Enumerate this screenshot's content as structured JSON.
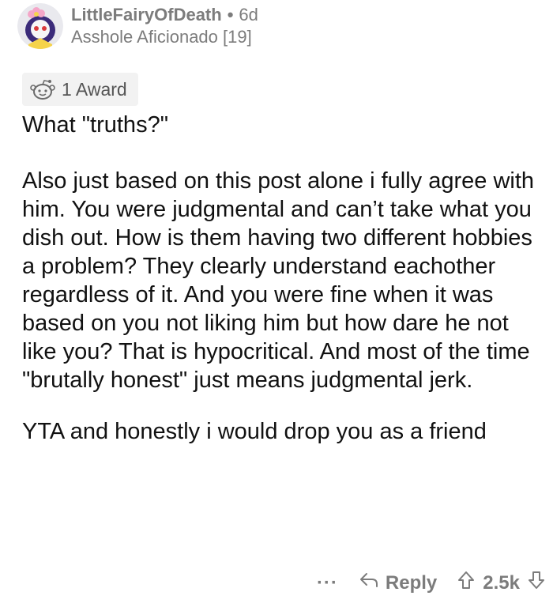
{
  "comment": {
    "username": "LittleFairyOfDeath",
    "separator": "•",
    "age": "6d",
    "flair": "Asshole Aficionado [19]",
    "award_label": "1 Award",
    "paragraphs": [
      "What \"truths?\"",
      "Also just based on this post alone i fully agree with him. You were judgmental and can’t take what you dish out. How is them having two different hobbies a problem? They clearly understand eachother regardless of it. And you were fine when it was based on you not liking him but how dare he not like you? That is hypocritical. And most of the time \"brutally honest\" just means judgmental jerk.",
      "YTA and honestly i would drop you as a friend"
    ]
  },
  "actions": {
    "more_label": "···",
    "reply_label": "Reply",
    "vote_count": "2.5k"
  },
  "icons": {
    "avatar": "avatar-icon",
    "award": "award-icon",
    "reply": "reply-icon",
    "upvote": "upvote-icon",
    "downvote": "downvote-icon"
  },
  "colors": {
    "meta_gray": "#7c7c7c",
    "award_bg": "#f2f2f2",
    "text": "#111111"
  }
}
